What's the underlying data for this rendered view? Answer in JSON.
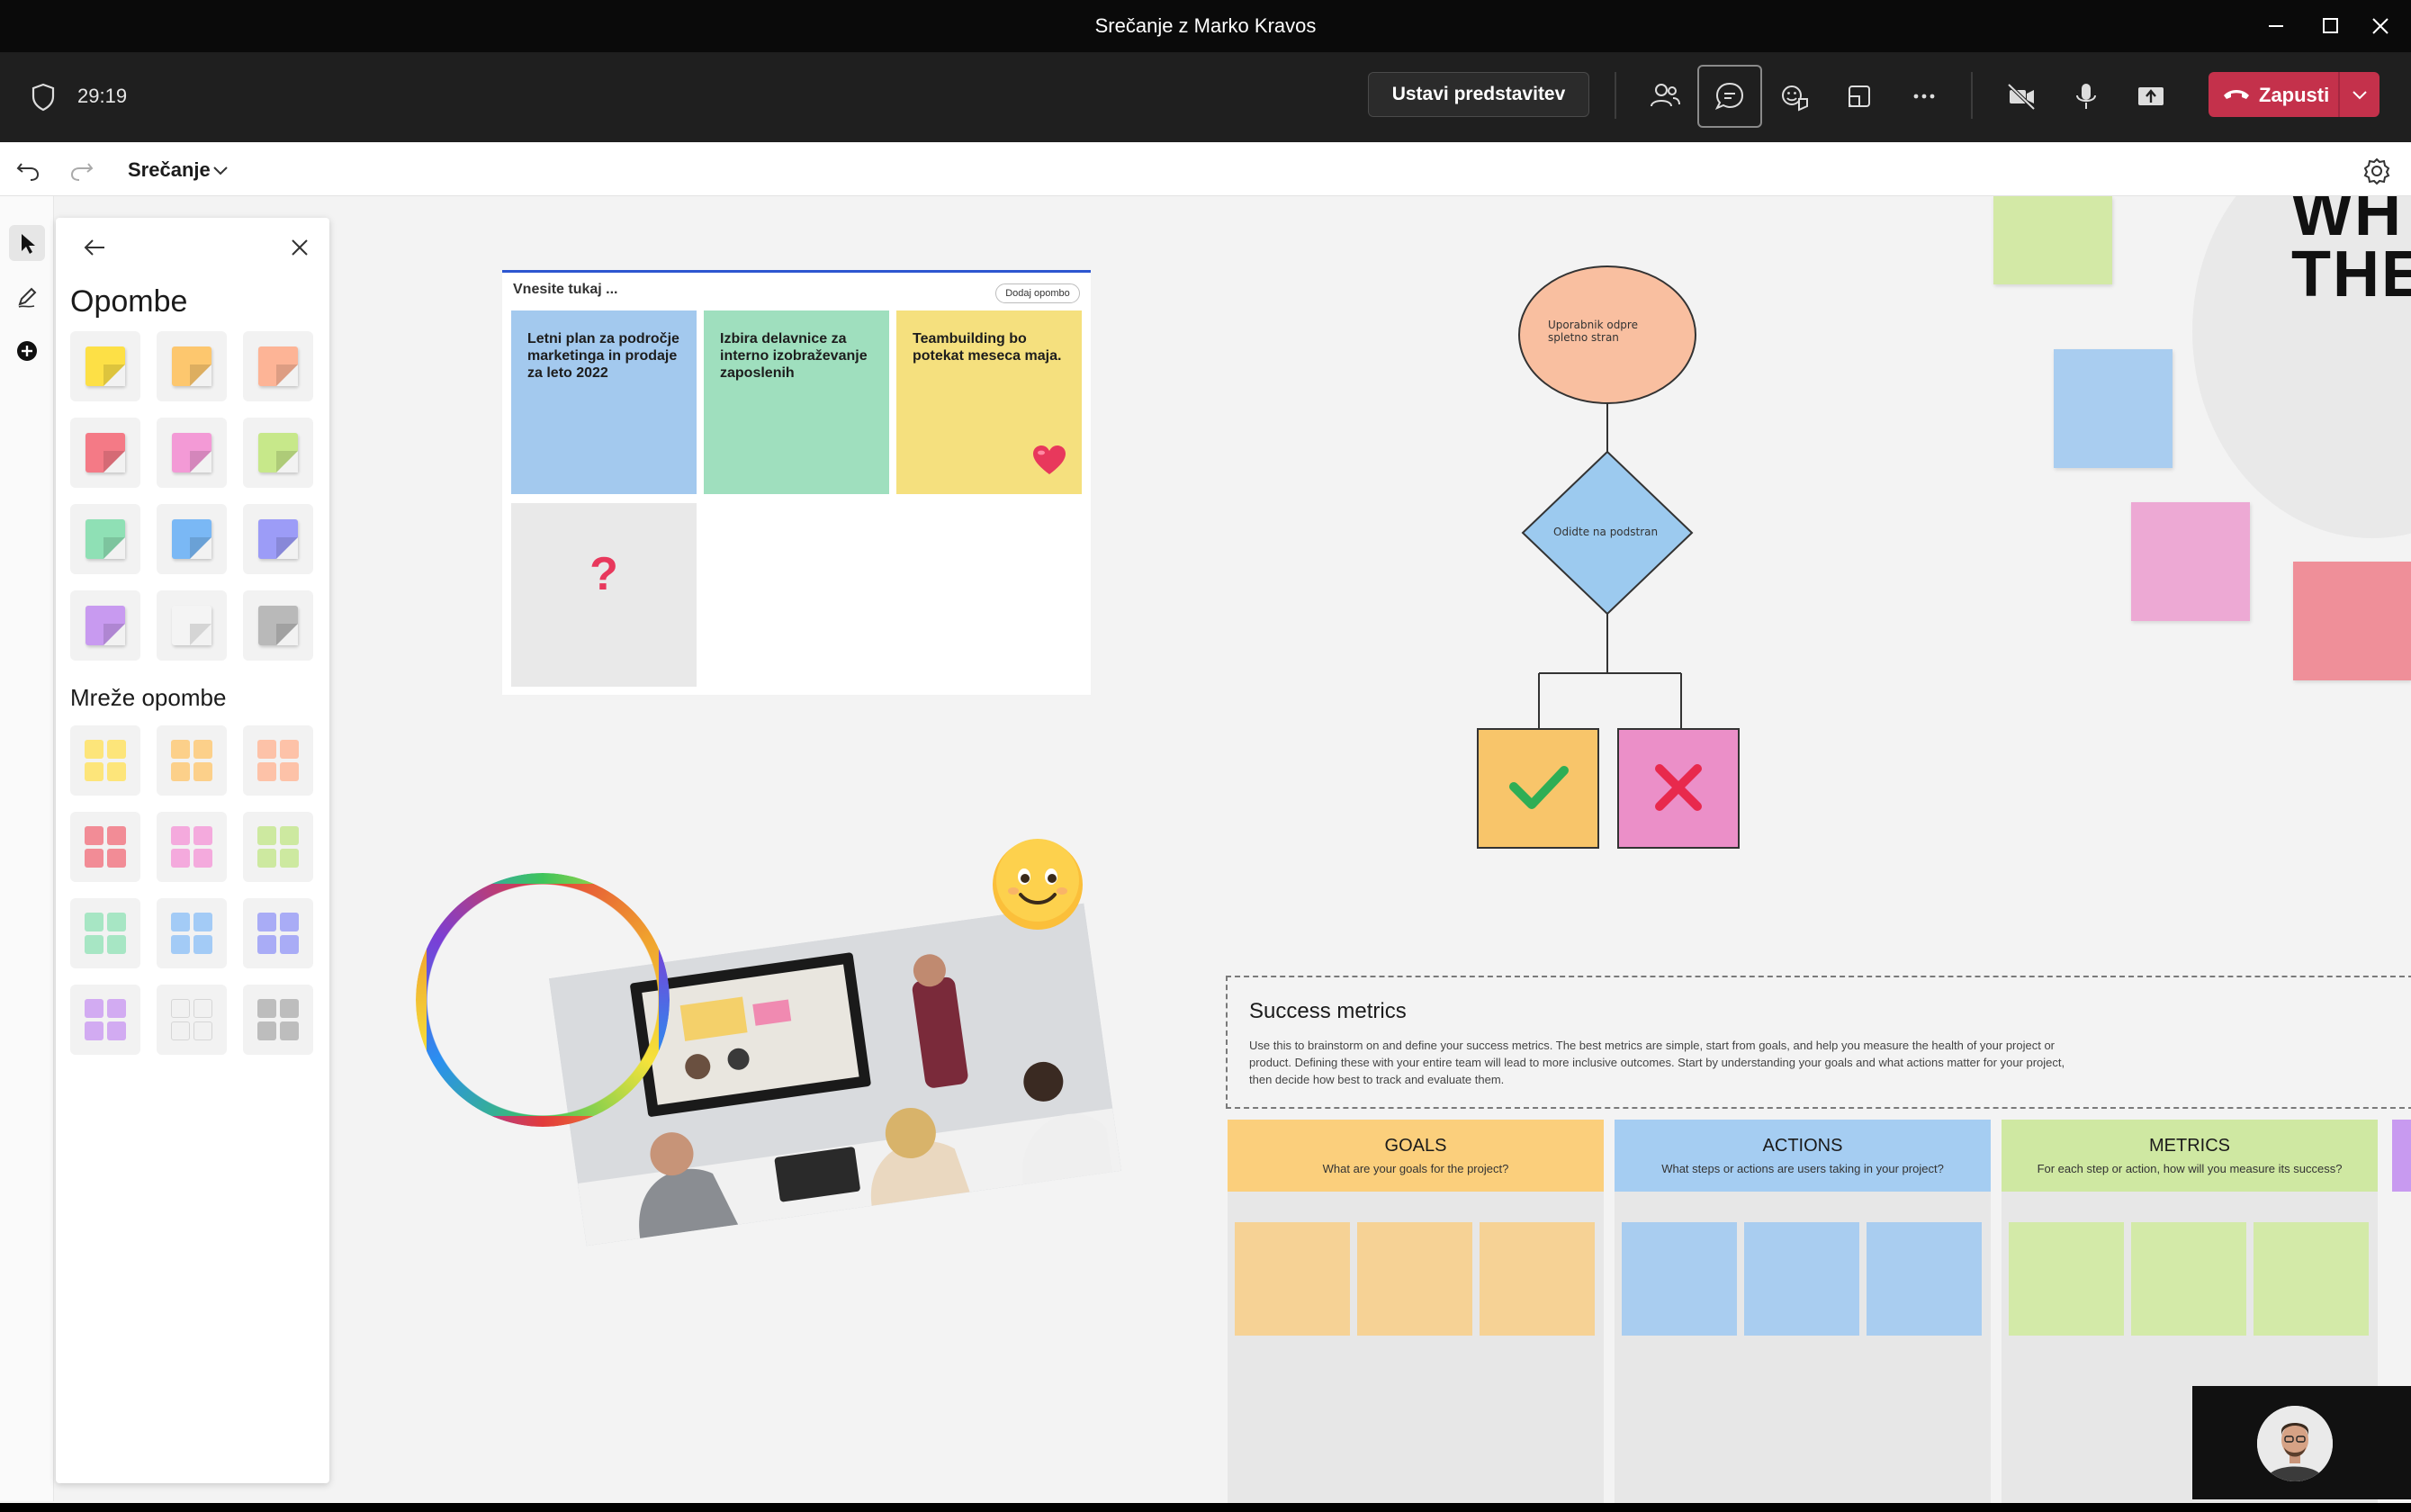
{
  "window": {
    "title": "Srečanje z Marko Kravos"
  },
  "meeting_toolbar": {
    "timer": "29:19",
    "stop_presenting_label": "Ustavi predstavitev",
    "leave_label": "Zapusti",
    "icons": [
      "shield-icon",
      "people-icon",
      "chat-icon",
      "reactions-icon",
      "rooms-icon",
      "more-icon",
      "camera-off-icon",
      "microphone-icon",
      "share-tray-icon",
      "phone-hangup-icon"
    ]
  },
  "whiteboard": {
    "board_name": "Srečanje"
  },
  "notes_panel": {
    "title": "Opombe",
    "grids_title": "Mreže opombe",
    "note_colors": [
      "#fde046",
      "#fdc76e",
      "#fdb496",
      "#f47a86",
      "#f39ad6",
      "#c7e88a",
      "#8fe0b5",
      "#7ab8f5",
      "#9c9cf7",
      "#c89af0",
      "#f4f4f4",
      "#b9b9b9"
    ],
    "grid_colors": [
      "#fde57a",
      "#fcd08a",
      "#fdc2a8",
      "#f28c96",
      "#f4aadd",
      "#cde9a0",
      "#a7e6c4",
      "#a3cbf6",
      "#a9acf6",
      "#d2abf2",
      "#f1f1f1",
      "#bdbdbd"
    ]
  },
  "notes_board": {
    "title": "Vnesite tukaj ...",
    "add_button": "Dodaj opombo",
    "notes": [
      {
        "text": "Letni plan za področje marketinga in prodaje za leto 2022",
        "color": "#a3c9ee"
      },
      {
        "text": "Izbira delavnice za interno izobraževanje zaposlenih",
        "color": "#9fdfbe"
      },
      {
        "text": "Teambuilding bo potekat meseca maja.",
        "color": "#f5e07e"
      },
      {
        "text": "?",
        "color": "#e9e9e9"
      }
    ]
  },
  "flowchart": {
    "start_label": "Uporabnik odpre spletno stran",
    "decision_label": "Odidte na podstran"
  },
  "success_metrics": {
    "title": "Success metrics",
    "description": "Use this to brainstorm on and define your success metrics. The best metrics are simple, start from goals, and help you measure the health of your project or product. Defining these with your entire team will lead to more inclusive outcomes. Start by understanding your goals and what actions matter for your project, then decide how best to track and evaluate them.",
    "columns": [
      {
        "title": "GOALS",
        "subtitle": "What are your goals for the project?",
        "header_color": "#fbcf7c",
        "cell_color": "#f6d295"
      },
      {
        "title": "ACTIONS",
        "subtitle": "What steps or actions are users taking in your project?",
        "header_color": "#a5cdf2",
        "cell_color": "#a9cdf0"
      },
      {
        "title": "METRICS",
        "subtitle": "For each step or action, how will you measure its success?",
        "header_color": "#cfe8a2",
        "cell_color": "#d3eaa8"
      }
    ]
  },
  "canvas_text": {
    "big_line_1": "WH",
    "big_line_2": "THE"
  }
}
